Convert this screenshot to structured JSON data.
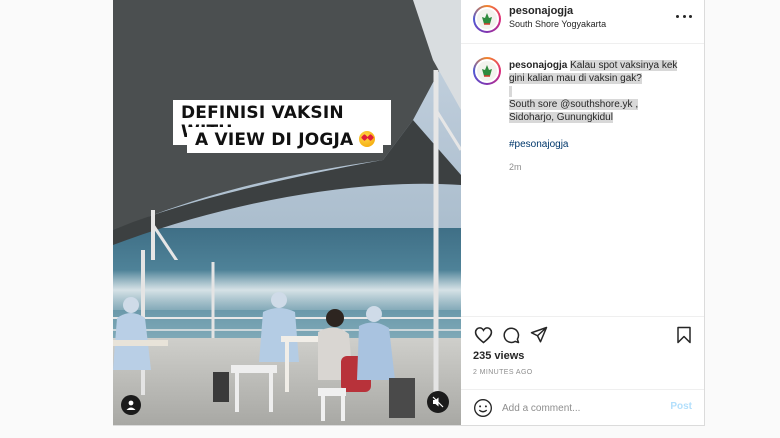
{
  "media": {
    "caption_line1": "DEFINISI VAKSIN WITH",
    "caption_line2": "A VIEW DI JOGJA",
    "caption_emoji": "heart-eyes-emoji",
    "user_tag_icon": "user-icon",
    "mute_icon": "speaker-muted-icon"
  },
  "header": {
    "username": "pesonajogja",
    "location": "South Shore Yogyakarta",
    "more_icon": "more-horizontal-icon"
  },
  "caption": {
    "username": "pesonajogja",
    "text_line1": "Kalau spot vaksinya kek",
    "text_line2": "gini kalian mau di vaksin gak?",
    "text_line3": "South sore @southshore.yk ,",
    "text_line4": "Sidoharjo, Gunungkidul",
    "hashtag": "#pesonajogja",
    "time": "2m"
  },
  "actions": {
    "like_icon": "heart-icon",
    "comment_icon": "comment-icon",
    "share_icon": "send-icon",
    "save_icon": "bookmark-icon",
    "views": "235 views",
    "time_ago": "2 MINUTES AGO"
  },
  "add_comment": {
    "emoji_icon": "smiley-icon",
    "placeholder": "Add a comment...",
    "post_label": "Post"
  },
  "colors": {
    "link": "#00376b",
    "muted": "#8e8e8e",
    "post_disabled": "#b2dffc",
    "text": "#262626"
  }
}
